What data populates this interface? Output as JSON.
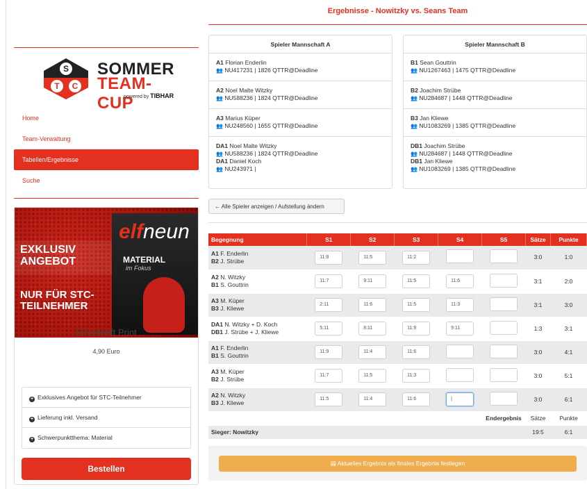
{
  "sidebar": {
    "logo": {
      "letters": [
        "S",
        "T",
        "C"
      ],
      "line1": "SOMMER",
      "line2": "TEAM-CUP",
      "powered": "powered by",
      "brand": "TIBHAR"
    },
    "nav": [
      "Home",
      "Team-Verwaltung",
      "Tabellen/Ergebnisse",
      "Suche"
    ],
    "active_nav": "Tabellen/Ergebnisse",
    "promo": {
      "banner_line1": "EXKLUSIV",
      "banner_line2": "ANGEBOT",
      "banner_line3": "NUR FÜR STC-",
      "banner_line4": "TEILNEHMER",
      "mag_title_a": "elf",
      "mag_title_b": "neun",
      "mag_sub": "MATERIAL",
      "mag_sub2": "im Fokus",
      "title": "Einzelheft Print",
      "price": "4,90 Euro",
      "features": [
        "Exklusives Angebot für STC-Teilnehmer",
        "Lieferung inkl. Versand",
        "Schwerpunktthema: Material"
      ],
      "order": "Bestellen"
    }
  },
  "main": {
    "title": "Ergebnisse - Nowitzky vs. Seans Team",
    "team_a": {
      "header": "Spieler Mannschaft A",
      "players": [
        {
          "pos": "A1",
          "name": "Florian Enderlin",
          "info": "NU417231 | 1826 QTTR@Deadline"
        },
        {
          "pos": "A2",
          "name": "Noel Malte Witzky",
          "info": "NU588236 | 1824 QTTR@Deadline"
        },
        {
          "pos": "A3",
          "name": "Marius Küper",
          "info": "NU248560 | 1655 QTTR@Deadline"
        }
      ],
      "doubles": [
        {
          "pos": "DA1",
          "name": "Noel Malte Witzky",
          "info": "NU588236 | 1824 QTTR@Deadline"
        },
        {
          "pos": "DA1",
          "name": "Daniel Koch",
          "info": "NU243971 |"
        }
      ]
    },
    "team_b": {
      "header": "Spieler Mannschaft B",
      "players": [
        {
          "pos": "B1",
          "name": "Sean Gouttrin",
          "info": "NU1267463 | 1475 QTTR@Deadline"
        },
        {
          "pos": "B2",
          "name": "Joachim Strübe",
          "info": "NU284687 | 1448 QTTR@Deadline"
        },
        {
          "pos": "B3",
          "name": "Jan Kliewe",
          "info": "NU1083269 | 1385 QTTR@Deadline"
        }
      ],
      "doubles": [
        {
          "pos": "DB1",
          "name": "Joachim Strübe",
          "info": "NU284687 | 1448 QTTR@Deadline"
        },
        {
          "pos": "DB1",
          "name": "Jan Kliewe",
          "info": "NU1083269 | 1385 QTTR@Deadline"
        }
      ]
    },
    "show_all_btn": "Alle Spieler anzeigen / Aufstellung ändern",
    "table": {
      "headers": [
        "Begegnung",
        "S1",
        "S2",
        "S3",
        "S4",
        "S5",
        "Sätze",
        "Punkte"
      ],
      "rows": [
        {
          "p1pos": "A1",
          "p1": "F. Enderlin",
          "p2pos": "B2",
          "p2": "J. Strübe",
          "sets": [
            "11:8",
            "11:5",
            "11:2",
            "",
            ""
          ],
          "saetze": "3:0",
          "punkte": "1:0"
        },
        {
          "p1pos": "A2",
          "p1": "N. Witzky",
          "p2pos": "B1",
          "p2": "S. Gouttrin",
          "sets": [
            "11:7",
            "9:11",
            "11:5",
            "11:6",
            ""
          ],
          "saetze": "3:1",
          "punkte": "2:0"
        },
        {
          "p1pos": "A3",
          "p1": "M. Küper",
          "p2pos": "B3",
          "p2": "J. Kliewe",
          "sets": [
            "2:11",
            "11:6",
            "11:5",
            "11:3",
            ""
          ],
          "saetze": "3:1",
          "punkte": "3:0"
        },
        {
          "p1pos": "DA1",
          "p1": "N. Witzky + D. Koch",
          "p2pos": "DB1",
          "p2": "J. Strübe + J. Kliewe",
          "sets": [
            "5:11",
            "8:11",
            "11:9",
            "9:11",
            ""
          ],
          "saetze": "1:3",
          "punkte": "3:1"
        },
        {
          "p1pos": "A1",
          "p1": "F. Enderlin",
          "p2pos": "B1",
          "p2": "S. Gouttrin",
          "sets": [
            "11:9",
            "11:4",
            "11:6",
            "",
            ""
          ],
          "saetze": "3:0",
          "punkte": "4:1"
        },
        {
          "p1pos": "A3",
          "p1": "M. Küper",
          "p2pos": "B2",
          "p2": "J. Strübe",
          "sets": [
            "11:7",
            "11:5",
            "11:3",
            "",
            ""
          ],
          "saetze": "3:0",
          "punkte": "5:1"
        },
        {
          "p1pos": "A2",
          "p1": "N. Witzky",
          "p2pos": "B3",
          "p2": "J. Kliewe",
          "sets": [
            "11:5",
            "11:4",
            "11:6",
            "|",
            ""
          ],
          "saetze": "3:0",
          "punkte": "6:1"
        }
      ],
      "summary_label": "Endergebnis",
      "summary_saetze": "Sätze",
      "summary_punkte": "Punkte",
      "winner": "Sieger: Nowitzky",
      "winner_saetze": "19:5",
      "winner_punkte": "6:1"
    },
    "final_btn": "Aktuelles Ergebnis als finales Ergebnis festlegen"
  },
  "colors": {
    "accent": "#e3301f",
    "warning": "#f0ad4e",
    "row_alt": "#e9eaec"
  }
}
